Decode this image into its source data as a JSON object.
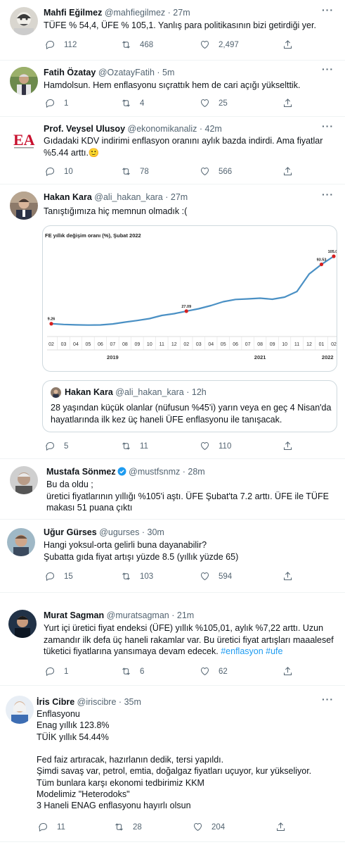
{
  "tweets": [
    {
      "name": "Mahfi Eğilmez",
      "handle": "@mahfiegilmez",
      "time": "27m",
      "text": [
        "TÜFE % 54,4, ÜFE % 105,1. Yanlış para politikasının bizi getirdiği yer."
      ],
      "replies": "112",
      "retweets": "468",
      "likes": "2,497"
    },
    {
      "name": "Fatih Özatay",
      "handle": "@OzatayFatih",
      "time": "5m",
      "text": [
        "Hamdolsun. Hem enflasyonu sıçrattık hem de cari açığı yükselttik."
      ],
      "replies": "1",
      "retweets": "4",
      "likes": "25"
    },
    {
      "name": "Prof. Veysel Ulusoy",
      "handle": "@ekonomikanaliz",
      "time": "42m",
      "text": [
        "Gıdadaki KDV indirimi enflasyon oranını aylık bazda indirdi. Ama fiyatlar",
        "%5.44 arttı.🙂"
      ],
      "replies": "10",
      "retweets": "78",
      "likes": "566"
    },
    {
      "name": "Hakan Kara",
      "handle": "@ali_hakan_kara",
      "time": "27m",
      "text": [
        "Tanıştığımıza hiç memnun olmadık :("
      ],
      "replies": "5",
      "retweets": "11",
      "likes": "110"
    },
    {
      "name": "Mustafa Sönmez",
      "handle": "@mustfsnmz",
      "time": "28m",
      "text": [
        "Bu da oldu ;",
        "üretici fiyatlarının yıllığı %105'i aştı. ÜFE Şubat'ta 7.2 arttı. ÜFE ile TÜFE",
        "makası 51 puana çıktı"
      ]
    },
    {
      "name": "Uğur Gürses",
      "handle": "@ugurses",
      "time": "30m",
      "text": [
        "Hangi yoksul-orta gelirli buna dayanabilir?",
        "Şubatta gıda fiyat artışı yüzde 8.5 (yıllık yüzde 65)"
      ],
      "replies": "15",
      "retweets": "103",
      "likes": "594"
    },
    {
      "name": "Murat Sagman",
      "handle": "@muratsagman",
      "time": "21m",
      "text": [
        "Yurt içi üretici fiyat endeksi (ÜFE) yıllık %105,01, aylık %7,22 arttı. Uzun",
        "zamandır ilk defa üç haneli rakamlar var. Bu üretici fiyat artışları maaalesef",
        "tüketici fiyatlarına yansımaya devam edecek."
      ],
      "hashtags": "#enflasyon #ufe",
      "replies": "1",
      "retweets": "6",
      "likes": "62"
    },
    {
      "name": "İris Cibre",
      "handle": "@iriscibre",
      "time": "35m",
      "text": [
        "Enflasyonu",
        "Enag yıllık 123.8%",
        "TÜİK yıllık 54.44%",
        "",
        "Fed faiz artıracak, hazırlanın dedik, tersi yapıldı.",
        "Şimdi savaş var, petrol, emtia, doğalgaz fiyatları uçuyor, kur yükseliyor.",
        "Tüm bunlara karşı ekonomi tedbirimiz KKM",
        "Modelimiz \"Heterodoks\"",
        "3 Haneli ENAG enflasyonu hayırlı olsun"
      ],
      "replies": "11",
      "retweets": "28",
      "likes": "204"
    }
  ],
  "quote": {
    "name": "Hakan Kara",
    "handle": "@ali_hakan_kara",
    "time": "12h",
    "text": [
      "28 yaşından küçük olanlar (nüfusun %45'i) yarın veya en geç 4 Nisan'da",
      "hayatlarında ilk kez üç haneli ÜFE enflasyonu ile tanışacak."
    ]
  },
  "chart_data": {
    "type": "line",
    "title": "FE yıllık değişim oranı (%), Şubat 2022",
    "x_ticks": [
      "02",
      "03",
      "04",
      "05",
      "06",
      "07",
      "08",
      "09",
      "10",
      "11",
      "12",
      "02",
      "03",
      "04",
      "05",
      "06",
      "07",
      "08",
      "09",
      "10",
      "11",
      "12",
      "01",
      "02"
    ],
    "year_labels": [
      "2019",
      "2021",
      "2022"
    ],
    "series": [
      {
        "values": [
          9.26,
          8.2,
          7.6,
          7.3,
          7.5,
          8.9,
          11.5,
          13.8,
          16.5,
          21.0,
          23.5,
          27.09,
          30.5,
          35.0,
          40.5,
          43.7,
          44.5,
          45.5,
          44.0,
          47.0,
          55.0,
          79.9,
          93.53,
          105.01
        ],
        "color": "#4a90c4"
      }
    ],
    "data_labels": [
      {
        "index": 0,
        "label": "9.26"
      },
      {
        "index": 11,
        "label": "27.09"
      },
      {
        "index": 22,
        "label": "93.53"
      },
      {
        "index": 23,
        "label": "105.01"
      }
    ],
    "highlight_color": "#d62020",
    "ylim": [
      0,
      120
    ]
  }
}
